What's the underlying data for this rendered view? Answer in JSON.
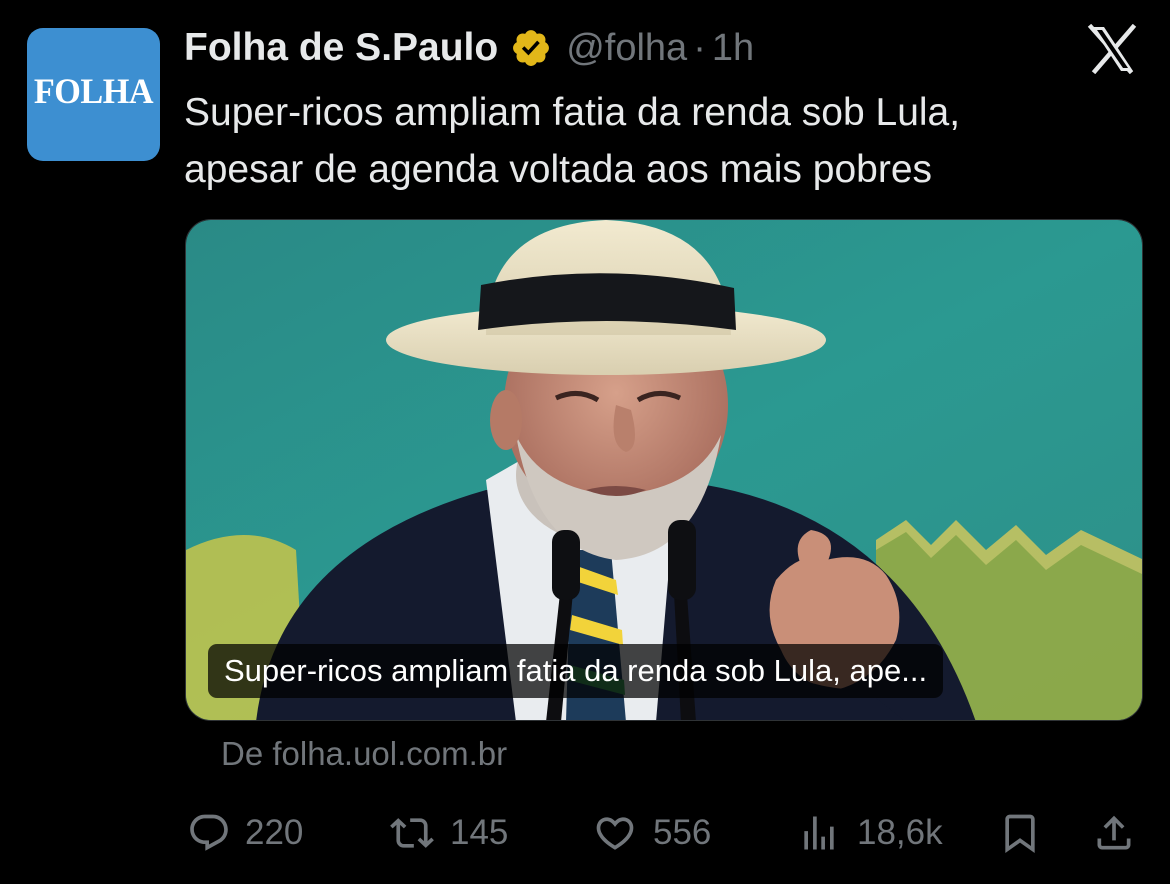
{
  "author": {
    "display_name": "Folha de S.Paulo",
    "handle": "@folha",
    "separator": "·",
    "time_ago": "1h",
    "avatar_text": "FOLHA",
    "verified_badge_icon": "verified-gold-badge",
    "brand_color": "#3d8fd1"
  },
  "tweet": {
    "text_line1": "Super-ricos ampliam fatia da renda sob Lula,",
    "text_line2": "apesar de agenda voltada aos mais pobres"
  },
  "card": {
    "title": "Super-ricos ampliam fatia da renda sob Lula, ape...",
    "source": "De folha.uol.com.br"
  },
  "metrics": {
    "replies": "220",
    "reposts": "145",
    "likes": "556",
    "views": "18,6k"
  },
  "icons": {
    "app": "x-logo-icon",
    "reply": "reply-icon",
    "repost": "repost-icon",
    "like": "heart-icon",
    "views": "views-icon",
    "bookmark": "bookmark-icon",
    "share": "share-icon"
  },
  "colors": {
    "background": "#000000",
    "text": "#e7e9ea",
    "muted": "#71767b",
    "badge_gold": "#e2b719"
  }
}
